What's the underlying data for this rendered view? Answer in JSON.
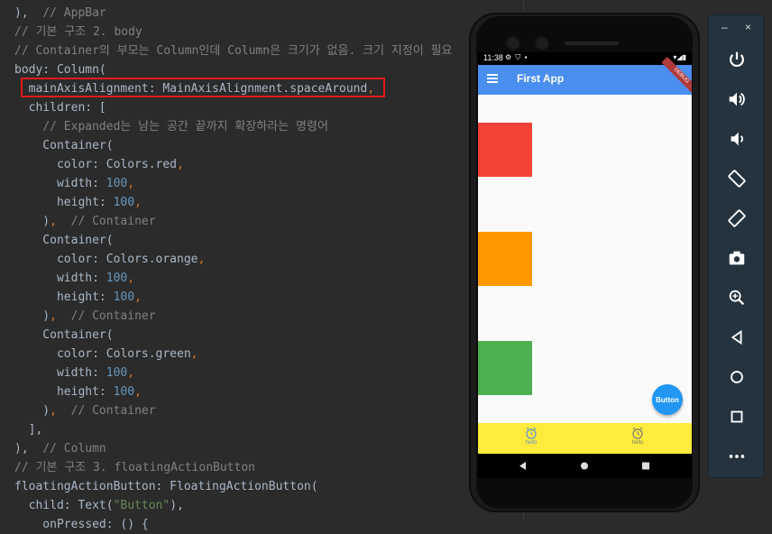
{
  "code_lines": [
    {
      "segments": [
        {
          "t": "),  ",
          "c": ""
        },
        {
          "t": "// AppBar",
          "c": "cmt"
        }
      ]
    },
    {
      "segments": [
        {
          "t": "// 기본 구조 2. body",
          "c": "cmt"
        }
      ]
    },
    {
      "segments": [
        {
          "t": "// Container의 부모는 Column인데 Column은 크기가 없음. 크기 지정이 필요",
          "c": "cmt"
        }
      ]
    },
    {
      "segments": [
        {
          "t": "body: Column(",
          "c": ""
        }
      ]
    },
    {
      "segments": [
        {
          "t": "  mainAxisAlignment: MainAxisAlignment.spaceAround",
          "c": ""
        },
        {
          "t": ",",
          "c": "pun"
        }
      ]
    },
    {
      "segments": [
        {
          "t": "  children: [",
          "c": ""
        }
      ]
    },
    {
      "segments": [
        {
          "t": "    ",
          "c": ""
        },
        {
          "t": "// Expanded는 남는 공간 끝까지 확장하라는 명령어",
          "c": "cmt"
        }
      ]
    },
    {
      "segments": [
        {
          "t": "    Container(",
          "c": ""
        }
      ]
    },
    {
      "segments": [
        {
          "t": "      color: Colors.red",
          "c": ""
        },
        {
          "t": ",",
          "c": "pun"
        }
      ]
    },
    {
      "segments": [
        {
          "t": "      width: ",
          "c": ""
        },
        {
          "t": "100",
          "c": "num"
        },
        {
          "t": ",",
          "c": "pun"
        }
      ]
    },
    {
      "segments": [
        {
          "t": "      height: ",
          "c": ""
        },
        {
          "t": "100",
          "c": "num"
        },
        {
          "t": ",",
          "c": "pun"
        }
      ]
    },
    {
      "segments": [
        {
          "t": "    )",
          "c": ""
        },
        {
          "t": ",",
          "c": "pun"
        },
        {
          "t": "  ",
          "c": ""
        },
        {
          "t": "// Container",
          "c": "cmt"
        }
      ]
    },
    {
      "segments": [
        {
          "t": "    Container(",
          "c": ""
        }
      ]
    },
    {
      "segments": [
        {
          "t": "      color: Colors.orange",
          "c": ""
        },
        {
          "t": ",",
          "c": "pun"
        }
      ]
    },
    {
      "segments": [
        {
          "t": "      width: ",
          "c": ""
        },
        {
          "t": "100",
          "c": "num"
        },
        {
          "t": ",",
          "c": "pun"
        }
      ]
    },
    {
      "segments": [
        {
          "t": "      height: ",
          "c": ""
        },
        {
          "t": "100",
          "c": "num"
        },
        {
          "t": ",",
          "c": "pun"
        }
      ]
    },
    {
      "segments": [
        {
          "t": "    )",
          "c": ""
        },
        {
          "t": ",",
          "c": "pun"
        },
        {
          "t": "  ",
          "c": ""
        },
        {
          "t": "// Container",
          "c": "cmt"
        }
      ]
    },
    {
      "segments": [
        {
          "t": "    Container(",
          "c": ""
        }
      ]
    },
    {
      "segments": [
        {
          "t": "      color: Colors.green",
          "c": ""
        },
        {
          "t": ",",
          "c": "pun"
        }
      ]
    },
    {
      "segments": [
        {
          "t": "      width: ",
          "c": ""
        },
        {
          "t": "100",
          "c": "num"
        },
        {
          "t": ",",
          "c": "pun"
        }
      ]
    },
    {
      "segments": [
        {
          "t": "      height: ",
          "c": ""
        },
        {
          "t": "100",
          "c": "num"
        },
        {
          "t": ",",
          "c": "pun"
        }
      ]
    },
    {
      "segments": [
        {
          "t": "    )",
          "c": ""
        },
        {
          "t": ",",
          "c": "pun"
        },
        {
          "t": "  ",
          "c": ""
        },
        {
          "t": "// Container",
          "c": "cmt"
        }
      ]
    },
    {
      "segments": [
        {
          "t": "  ],",
          "c": ""
        }
      ]
    },
    {
      "segments": [
        {
          "t": "),  ",
          "c": ""
        },
        {
          "t": "// Column",
          "c": "cmt"
        }
      ]
    },
    {
      "segments": [
        {
          "t": "// 기본 구조 3. floatingActionButton",
          "c": "cmt"
        }
      ]
    },
    {
      "segments": [
        {
          "t": "floatingActionButton: FloatingActionButton(",
          "c": ""
        }
      ]
    },
    {
      "segments": [
        {
          "t": "  child: Text(",
          "c": ""
        },
        {
          "t": "\"Button\"",
          "c": "str"
        },
        {
          "t": "),",
          "c": ""
        }
      ]
    },
    {
      "segments": [
        {
          "t": "    onPressed: () {",
          "c": ""
        }
      ]
    }
  ],
  "colors": {
    "red": "#f44336",
    "orange": "#ff9800",
    "green": "#4caf50",
    "app_bar": "#4a8ef0",
    "fab": "#2196f3",
    "bottom_nav": "#ffeb3b",
    "highlight": "#e01b1b"
  },
  "phone": {
    "status": {
      "time": "11:38",
      "icons_left": "⚙ ⛉ ▪",
      "icons_right": "▾◢▮"
    },
    "app_bar": {
      "title": "First App",
      "debug_banner": "DEBUG"
    },
    "fab_label": "Button",
    "bottom_nav": [
      {
        "label": "hello",
        "icon": "alarm-icon",
        "active": true
      },
      {
        "label": "hello",
        "icon": "alarm-icon",
        "active": false
      }
    ]
  },
  "toolbar": {
    "minimize": "–",
    "close": "×",
    "tools": [
      "power-icon",
      "volume-up-icon",
      "volume-down-icon",
      "rotate-left-icon",
      "rotate-right-icon",
      "camera-icon",
      "zoom-icon",
      "back-icon",
      "home-icon",
      "overview-icon",
      "more-icon"
    ]
  }
}
